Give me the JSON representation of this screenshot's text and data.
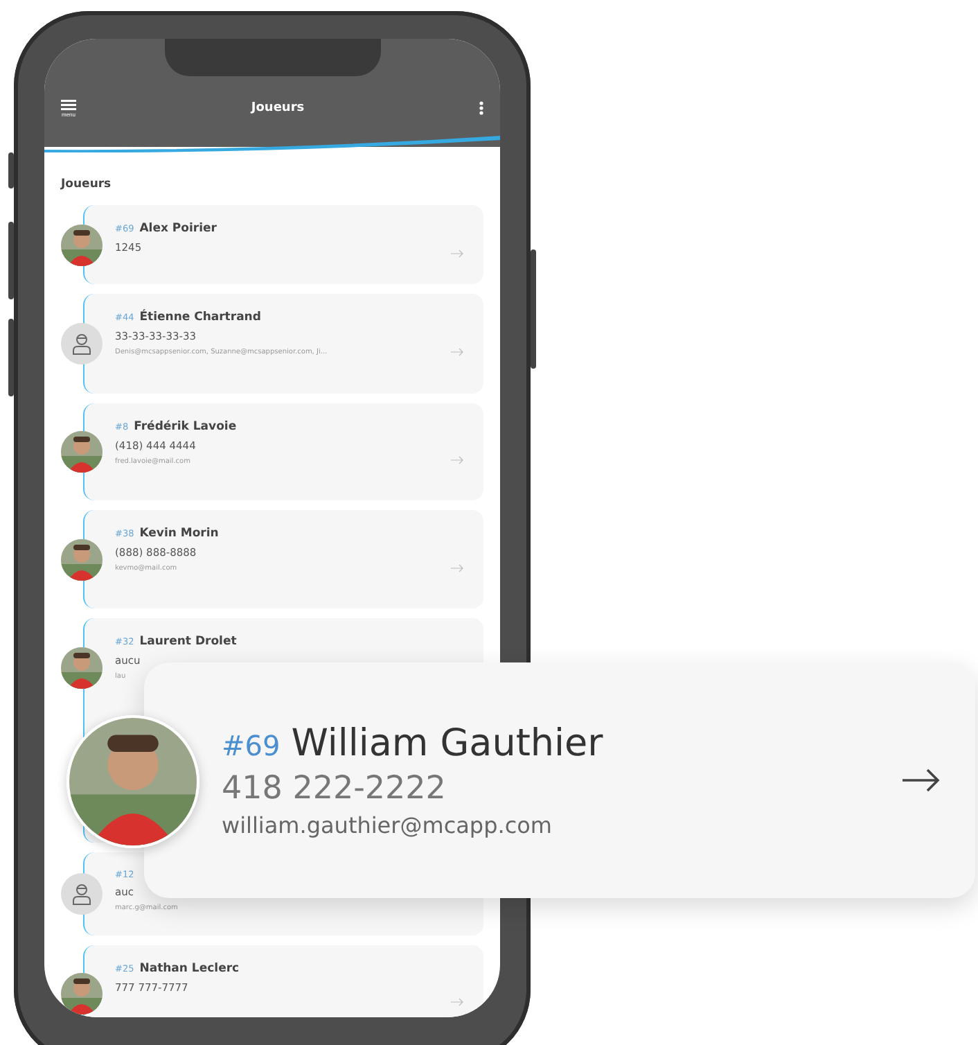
{
  "header": {
    "title": "Joueurs",
    "menu_label": "menu"
  },
  "section_title": "Joueurs",
  "players": [
    {
      "number": "#69",
      "name": "Alex Poirier",
      "phone": "1245",
      "arrow": true
    },
    {
      "number": "#44",
      "name": "Étienne Chartrand",
      "phone": "33-33-33-33-33",
      "email": "Denis@mcsappsenior.com, Suzanne@mcsappsenior.com, Ji...",
      "kind": "placeholder",
      "arrow": true
    },
    {
      "number": "#8",
      "name": "Frédérik Lavoie",
      "phone": "(418) 444 4444",
      "email": "fred.lavoie@mail.com",
      "arrow": true
    },
    {
      "number": "#38",
      "name": "Kevin Morin",
      "phone": "(888) 888-8888",
      "email": "kevmo@mail.com",
      "arrow": true
    },
    {
      "number": "#32",
      "name": "Laurent Drolet",
      "phone": "aucu",
      "email": "lau",
      "arrow": false
    },
    {
      "number": "#12",
      "phone": "auc",
      "email": "marc.g@mail.com",
      "kind": "placeholder",
      "arrow": false
    },
    {
      "number": "#25",
      "name": "Nathan Leclerc",
      "phone": "777 777-7777",
      "arrow": true
    }
  ],
  "featured": {
    "number": "#69",
    "name": "William Gauthier",
    "phone": "418 222-2222",
    "email": "william.gauthier@mcapp.com"
  }
}
